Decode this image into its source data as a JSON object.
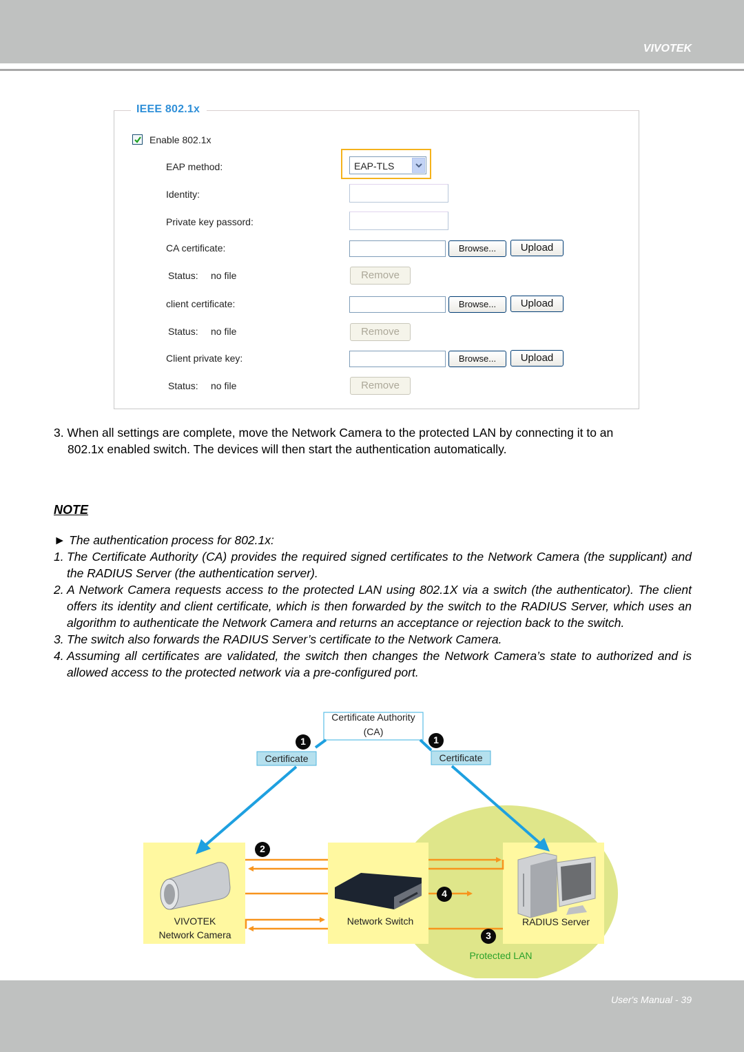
{
  "header": {
    "brand": "VIVOTEK"
  },
  "panel": {
    "legend": "IEEE 802.1x",
    "enable_checkbox": {
      "label": "Enable 802.1x",
      "checked": true
    },
    "eap_method": {
      "label": "EAP method:",
      "value": "EAP-TLS"
    },
    "identity": {
      "label": "Identity:",
      "value": ""
    },
    "private_key_password": {
      "label": "Private key passord:",
      "value": ""
    },
    "certificates": [
      {
        "label": "CA certificate:",
        "browse": "Browse...",
        "upload": "Upload",
        "status_label": "Status:",
        "status_value": "no file",
        "remove": "Remove"
      },
      {
        "label": "client certificate:",
        "browse": "Browse...",
        "upload": "Upload",
        "status_label": "Status:",
        "status_value": "no file",
        "remove": "Remove"
      },
      {
        "label": "Client private key:",
        "browse": "Browse...",
        "upload": "Upload",
        "status_label": "Status:",
        "status_value": "no file",
        "remove": "Remove"
      }
    ]
  },
  "step3": {
    "number": "3.",
    "line1": "When all settings are complete, move the Network Camera to the protected LAN by connecting it to an",
    "line2": "802.1x enabled switch. The devices will then start the authentication automatically."
  },
  "note": {
    "heading": "NOTE",
    "intro": "► The authentication process for 802.1x:",
    "items": [
      {
        "num": "1.",
        "text": "The Certificate Authority (CA) provides the required signed certificates to the Network Camera (the supplicant) and the RADIUS Server (the authentication server)."
      },
      {
        "num": "2.",
        "text": "A Network Camera requests access to the protected LAN using 802.1X via a switch (the authenticator). The client offers its identity and client certificate, which is then forwarded by the switch to the RADIUS Server, which uses an algorithm to authenticate the Network Camera and returns an acceptance or rejection back to the switch."
      },
      {
        "num": "3.",
        "text": "The switch also forwards the RADIUS Server’s certificate to the Network Camera."
      },
      {
        "num": "4.",
        "text": "Assuming all certificates are validated, the switch then changes the Network Camera’s state to authorized and is allowed access to the protected network via a pre-configured port."
      }
    ]
  },
  "diagram": {
    "ca_line1": "Certificate Authority",
    "ca_line2": "(CA)",
    "cert_left": "Certificate",
    "cert_right": "Certificate",
    "badges": [
      "1",
      "1",
      "2",
      "4",
      "3"
    ],
    "camera_line1": "VIVOTEK",
    "camera_line2": "Network Camera",
    "switch": "Network Switch",
    "server": "RADIUS Server",
    "zone": "Protected LAN",
    "colors": {
      "blue_arrow": "#1ea0e0",
      "orange_arrow": "#f7941d",
      "node_bg": "#fff8a0",
      "zone_bg": "#dfe68a",
      "zone_text": "#2aa12a"
    }
  },
  "footer": {
    "text": "User's Manual - 39"
  }
}
